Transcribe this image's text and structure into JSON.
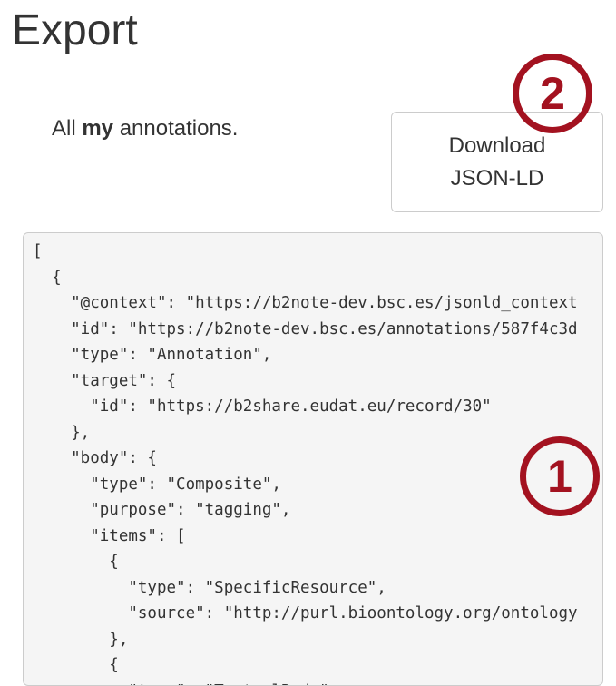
{
  "page": {
    "title": "Export"
  },
  "intro": {
    "prefix": "All ",
    "emphasis": "my",
    "suffix": " annotations."
  },
  "download_button": {
    "line1": "Download",
    "line2": "JSON-LD"
  },
  "code_lines": [
    "[",
    "  {",
    "    \"@context\": \"https://b2note-dev.bsc.es/jsonld_context",
    "    \"id\": \"https://b2note-dev.bsc.es/annotations/587f4c3d",
    "    \"type\": \"Annotation\",",
    "    \"target\": {",
    "      \"id\": \"https://b2share.eudat.eu/record/30\"",
    "    },",
    "    \"body\": {",
    "      \"type\": \"Composite\",",
    "      \"purpose\": \"tagging\",",
    "      \"items\": [",
    "        {",
    "          \"type\": \"SpecificResource\",",
    "          \"source\": \"http://purl.bioontology.org/ontology",
    "        },",
    "        {",
    "          \"type\": \"TextualBody\","
  ],
  "badges": {
    "code_marker": "1",
    "button_marker": "2",
    "color": "#a31220"
  }
}
